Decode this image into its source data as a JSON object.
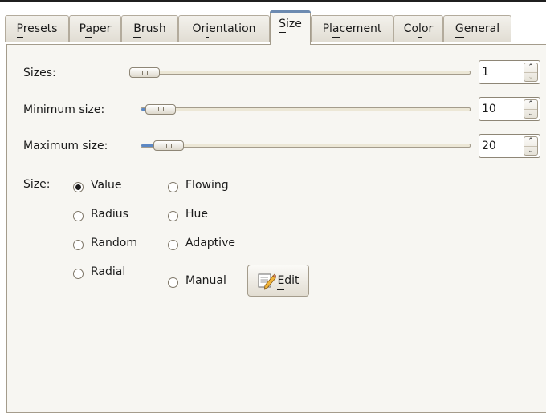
{
  "tabs": [
    {
      "label": "Presets",
      "mnemonic": "P",
      "active": false
    },
    {
      "label": "Paper",
      "mnemonic": "a",
      "active": false
    },
    {
      "label": "Brush",
      "mnemonic": "B",
      "active": false
    },
    {
      "label": "Orientation",
      "mnemonic": "i",
      "active": false
    },
    {
      "label": "Size",
      "mnemonic": "S",
      "active": true
    },
    {
      "label": "Placement",
      "mnemonic": "a",
      "active": false
    },
    {
      "label": "Color",
      "mnemonic": "l",
      "active": false
    },
    {
      "label": "General",
      "mnemonic": "G",
      "active": false
    }
  ],
  "size_panel": {
    "sizes": {
      "label": "Sizes:",
      "value": "1",
      "level": 0.0
    },
    "minimum_size": {
      "label": "Minimum size:",
      "value": "10",
      "level": 0.02
    },
    "maximum_size": {
      "label": "Maximum size:",
      "value": "20",
      "level": 0.06
    },
    "size_group_label": "Size:",
    "options": [
      {
        "label": "Value",
        "checked": true
      },
      {
        "label": "Radius",
        "checked": false
      },
      {
        "label": "Random",
        "checked": false
      },
      {
        "label": "Radial",
        "checked": false
      },
      {
        "label": "Flowing",
        "checked": false
      },
      {
        "label": "Hue",
        "checked": false
      },
      {
        "label": "Adaptive",
        "checked": false
      },
      {
        "label": "Manual",
        "checked": false
      }
    ],
    "edit_button": {
      "label": "Edit",
      "mnemonic": "E",
      "icon": "edit-pencil-icon"
    }
  },
  "colors": {
    "accent": "#5c88c4",
    "active_tab_highlight": "#6c8ab0",
    "panel_bg": "#f7f6f2"
  }
}
